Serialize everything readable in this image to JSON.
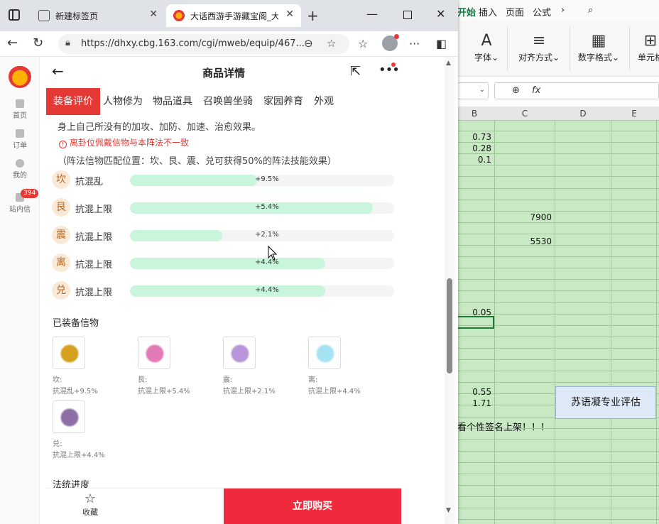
{
  "excel": {
    "tabs": [
      "开始",
      "插入",
      "页面",
      "公式"
    ],
    "ribbon": {
      "font": "字体",
      "align": "对齐方式",
      "number": "数字格式",
      "cell": "单元格"
    },
    "columns": [
      "B",
      "C",
      "D",
      "E"
    ],
    "cells": {
      "b1": "0.73",
      "b2": "0.28",
      "b3": "0.1",
      "c1": "7900",
      "c2": "5530",
      "b4": "0.05",
      "b5": "0.55",
      "b6": "1.71"
    },
    "note": "看个性签名上架！！！",
    "eval": "苏语凝专业评估"
  },
  "browser": {
    "tab_new": "新建标签页",
    "tab_active": "大话西游手游藏宝阁_大话",
    "url": "https://dhxy.cbg.163.com/cgi/mweb/equip/467..."
  },
  "rail": {
    "home": "首页",
    "orders": "订单",
    "mine": "我的",
    "messages": "站内信",
    "msg_count": "394"
  },
  "page": {
    "title": "商品详情",
    "tabs": [
      "装备评价",
      "人物修为",
      "物品道具",
      "召唤兽坐骑",
      "家园养育",
      "外观"
    ],
    "desc_top": "身上自己所没有的加攻、加防、加速、治愈效果。",
    "warning": "离卦位佩戴信物与本阵法不一致",
    "warning_note": "（阵法信物匹配位置：坎、艮、震、兑可获得50%的阵法技能效果）",
    "attrs": [
      {
        "badge": "坎",
        "name": "抗混乱",
        "value": "+9.5%",
        "level": 0.48
      },
      {
        "badge": "艮",
        "name": "抗混上限",
        "value": "+5.4%",
        "level": 0.92
      },
      {
        "badge": "震",
        "name": "抗混上限",
        "value": "+2.1%",
        "level": 0.35
      },
      {
        "badge": "离",
        "name": "抗混上限",
        "value": "+4.4%",
        "level": 0.74
      },
      {
        "badge": "兑",
        "name": "抗混上限",
        "value": "+4.4%",
        "level": 0.74
      }
    ],
    "equipped_title": "已装备信物",
    "items": [
      {
        "pos": "坎:",
        "effect": "抗混乱+9.5%",
        "color": "#d4a11e"
      },
      {
        "pos": "艮:",
        "effect": "抗混上限+5.4%",
        "color": "#e27ab6"
      },
      {
        "pos": "震:",
        "effect": "抗混上限+2.1%",
        "color": "#b895d8"
      },
      {
        "pos": "离:",
        "effect": "抗混上限+4.4%",
        "color": "#a6e3f2"
      },
      {
        "pos": "兑:",
        "effect": "抗混上限+4.4%",
        "color": "#8d6fa6"
      }
    ],
    "skill_title": "法统进度",
    "fav": "收藏",
    "buy": "立即购买"
  }
}
